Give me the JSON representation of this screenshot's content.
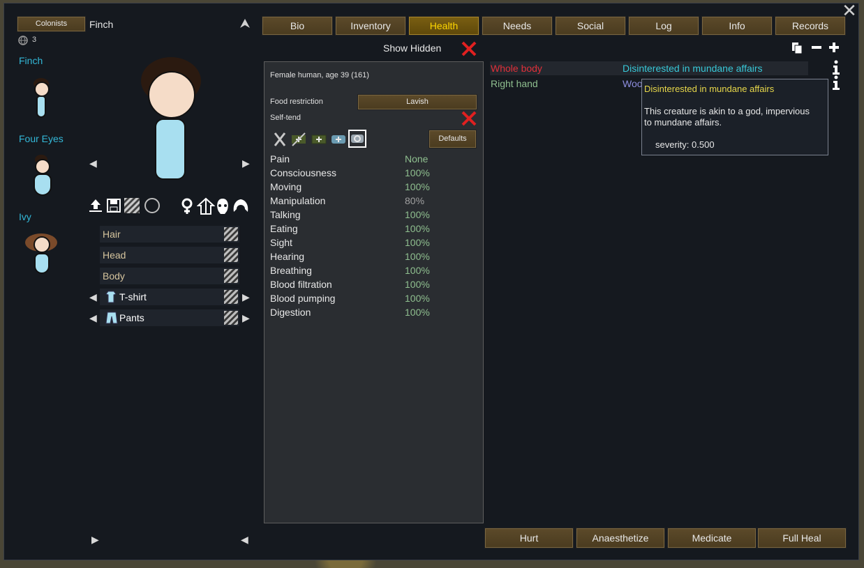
{
  "window": {
    "close_glyph": "✕"
  },
  "left": {
    "colonists_button": "Colonists",
    "current_name": "Finch",
    "count": "3",
    "colonists": [
      {
        "name": "Finch"
      },
      {
        "name": "Four Eyes"
      },
      {
        "name": "Ivy"
      }
    ],
    "apparel_rows": [
      {
        "label": "Hair",
        "arrows": false
      },
      {
        "label": "Head",
        "arrows": false
      },
      {
        "label": "Body",
        "arrows": false
      },
      {
        "label": "T-shirt",
        "arrows": true
      },
      {
        "label": "Pants",
        "arrows": true
      }
    ]
  },
  "tabs": [
    {
      "label": "Bio",
      "active": false
    },
    {
      "label": "Inventory",
      "active": false
    },
    {
      "label": "Health",
      "active": true
    },
    {
      "label": "Needs",
      "active": false
    },
    {
      "label": "Social",
      "active": false
    },
    {
      "label": "Log",
      "active": false
    },
    {
      "label": "Info",
      "active": false
    },
    {
      "label": "Records",
      "active": false
    }
  ],
  "health": {
    "show_hidden_label": "Show Hidden",
    "summary": "Female human, age 39 (161)",
    "food_restriction_label": "Food restriction",
    "food_restriction_value": "Lavish",
    "self_tend_label": "Self-tend",
    "defaults_button": "Defaults",
    "capacities": [
      {
        "name": "Pain",
        "value": "None",
        "color": "#8fbf8f"
      },
      {
        "name": "Consciousness",
        "value": "100%",
        "color": "#8fbf8f"
      },
      {
        "name": "Moving",
        "value": "100%",
        "color": "#8fbf8f"
      },
      {
        "name": "Manipulation",
        "value": "80%",
        "color": "#a0a0a0"
      },
      {
        "name": "Talking",
        "value": "100%",
        "color": "#8fbf8f"
      },
      {
        "name": "Eating",
        "value": "100%",
        "color": "#8fbf8f"
      },
      {
        "name": "Sight",
        "value": "100%",
        "color": "#8fbf8f"
      },
      {
        "name": "Hearing",
        "value": "100%",
        "color": "#8fbf8f"
      },
      {
        "name": "Breathing",
        "value": "100%",
        "color": "#8fbf8f"
      },
      {
        "name": "Blood filtration",
        "value": "100%",
        "color": "#8fbf8f"
      },
      {
        "name": "Blood pumping",
        "value": "100%",
        "color": "#8fbf8f"
      },
      {
        "name": "Digestion",
        "value": "100%",
        "color": "#8fbf8f"
      }
    ],
    "hediffs": [
      {
        "part": "Whole body",
        "part_color": "#e0303a",
        "condition": "Disinterested in mundane affairs",
        "cond_color": "#38c8d8"
      },
      {
        "part": "Right hand",
        "part_color": "#8fbf8f",
        "condition": "Wood",
        "cond_color": "#8e8ee0"
      }
    ],
    "tooltip": {
      "title": "Disinterested in mundane affairs",
      "body": "This creature is akin to a god, impervious to mundane affairs.",
      "severity": "severity: 0.500"
    }
  },
  "bottom_buttons": [
    "Hurt",
    "Anaesthetize",
    "Medicate",
    "Full Heal"
  ],
  "colors": {
    "accent": "#ffd700",
    "name_blue": "#33b8d8"
  }
}
